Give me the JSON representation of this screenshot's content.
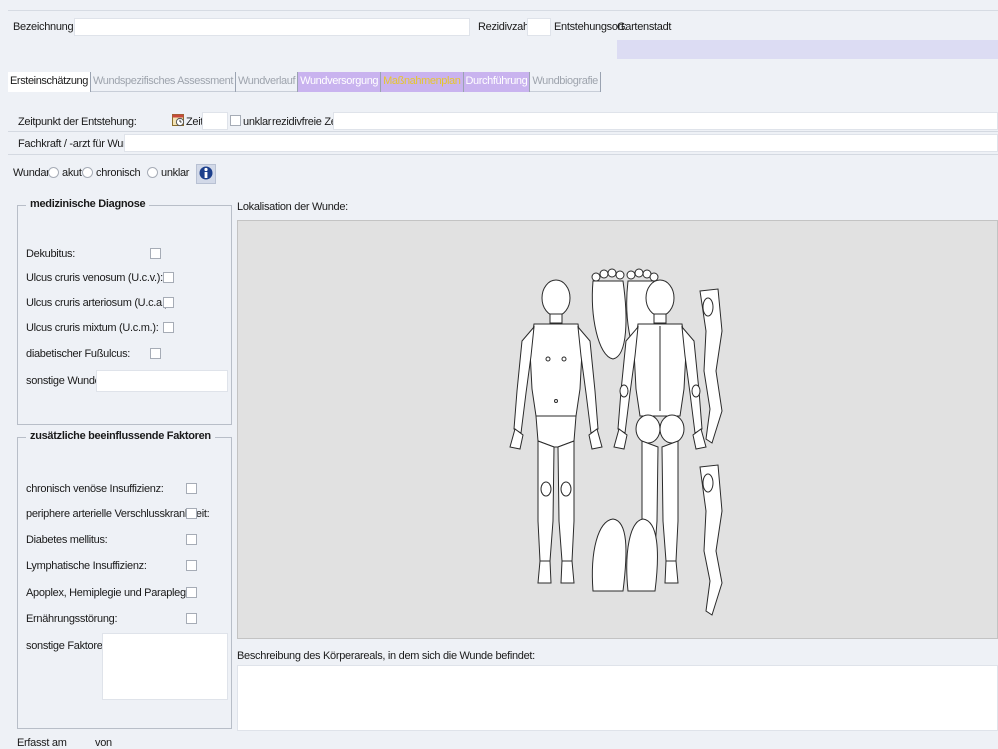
{
  "header": {
    "bezeichnung_label": "Bezeichnung:",
    "bezeichnung_value": "",
    "rezidivzahl_label": "Rezidivzahl:",
    "rezidivzahl_value": "",
    "entstehungsort_label": "Entstehungsort:",
    "entstehungsort_value": "Gartenstadt"
  },
  "tabs": [
    {
      "label": "Ersteinschätzung",
      "state": "active"
    },
    {
      "label": "Wundspezifisches Assessment",
      "state": "inactive"
    },
    {
      "label": "Wundverlauf",
      "state": "inactive"
    },
    {
      "label": "Wundversorgung",
      "state": "purple"
    },
    {
      "label": "Maßnahmenplan",
      "state": "yellow-on-purple"
    },
    {
      "label": "Durchführung",
      "state": "purple"
    },
    {
      "label": "Wundbiografie",
      "state": "inactive"
    }
  ],
  "form": {
    "zeitpunkt_label": "Zeitpunkt der Entstehung:",
    "zeit_label": "Zeit:",
    "zeit_value": "",
    "unklar_label": "unklar",
    "rezidivfreie_label": "rezidivfreie Zeit:",
    "rezidivfreie_value": "",
    "fachkraft_label": "Fachkraft / -arzt für Wunden:",
    "fachkraft_value": "",
    "wundart_label": "Wundart:",
    "wundart_options": [
      "akut",
      "chronisch",
      "unklar"
    ]
  },
  "diagnose": {
    "title": "medizinische Diagnose",
    "items": [
      "Dekubitus:",
      "Ulcus cruris venosum (U.c.v.):",
      "Ulcus cruris arteriosum (U.c.a.):",
      "Ulcus cruris mixtum (U.c.m.):",
      "diabetischer Fußulcus:"
    ],
    "sonstige_label": "sonstige Wunde:",
    "sonstige_value": ""
  },
  "faktoren": {
    "title": "zusätzliche beeinflussende Faktoren",
    "items": [
      "chronisch venöse Insuffizienz:",
      "periphere arterielle Verschlusskrankheit:",
      "Diabetes mellitus:",
      "Lymphatische Insuffizienz:",
      "Apoplex, Hemiplegie und Paraplegie:",
      "Ernährungsstörung:"
    ],
    "sonstige_label": "sonstige Faktoren:",
    "sonstige_value": ""
  },
  "lokalisation": {
    "label": "Lokalisation der Wunde:"
  },
  "beschreibung": {
    "label": "Beschreibung des Körperareals, in dem sich die Wunde befindet:",
    "value": ""
  },
  "footer": {
    "erfasst_label": "Erfasst am",
    "von_label": "von"
  },
  "colors": {
    "background": "#eef1f6",
    "tab_purple": "#c9b3ef",
    "tab_yellow": "#e6c62e",
    "strip_purple": "#dcdcf3",
    "canvas_gray": "#e1e1e1"
  },
  "icons": {
    "zeit": "calendar-clock-icon",
    "info": "info-person-icon"
  }
}
